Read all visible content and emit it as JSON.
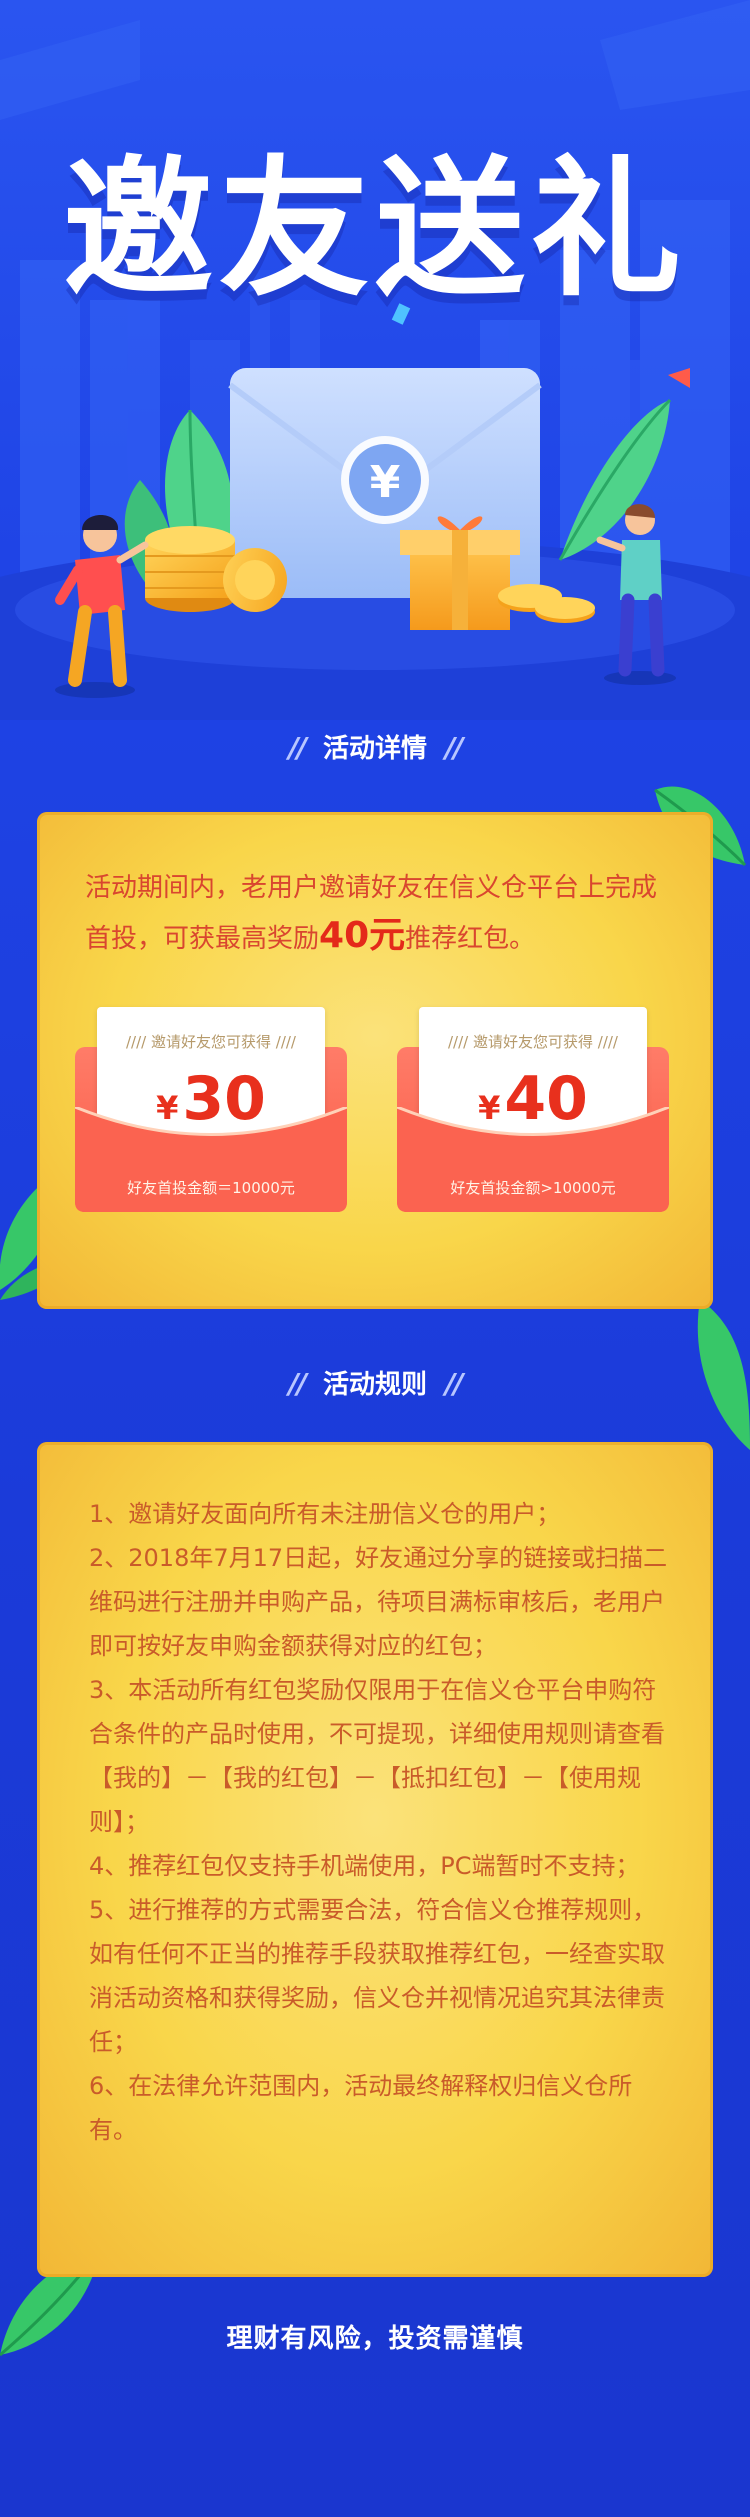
{
  "hero": {
    "title": "邀友送礼",
    "coin_symbol": "¥"
  },
  "details": {
    "heading": "活动详情",
    "intro_pre": "活动期间内，老用户邀请好友在信义仓平台上完成首投，可获最高奖励",
    "intro_highlight": "40元",
    "intro_post": "推荐红包。",
    "packets": [
      {
        "caption": "邀请好友您可获得",
        "currency": "¥",
        "amount": "30",
        "condition": "好友首投金额＝10000元"
      },
      {
        "caption": "邀请好友您可获得",
        "currency": "¥",
        "amount": "40",
        "condition": "好友首投金额>10000元"
      }
    ]
  },
  "rules": {
    "heading": "活动规则",
    "items": [
      "1、邀请好友面向所有未注册信义仓的用户；",
      "2、2018年7月17日起，好友通过分享的链接或扫描二维码进行注册并申购产品，待项目满标审核后，老用户即可按好友申购金额获得对应的红包；",
      "3、本活动所有红包奖励仅限用于在信义仓平台申购符合条件的产品时使用，不可提现，详细使用规则请查看【我的】－【我的红包】－【抵扣红包】－【使用规则】；",
      "4、推荐红包仅支持手机端使用，PC端暂时不支持；",
      "5、进行推荐的方式需要合法，符合信义仓推荐规则，如有任何不正当的推荐手段获取推荐红包，一经查实取消活动资格和获得奖励，信义仓并视情况追究其法律责任；",
      "6、在法律允许范围内，活动最终解释权归信义仓所有。"
    ]
  },
  "footer": {
    "text": "理财有风险，投资需谨慎"
  }
}
